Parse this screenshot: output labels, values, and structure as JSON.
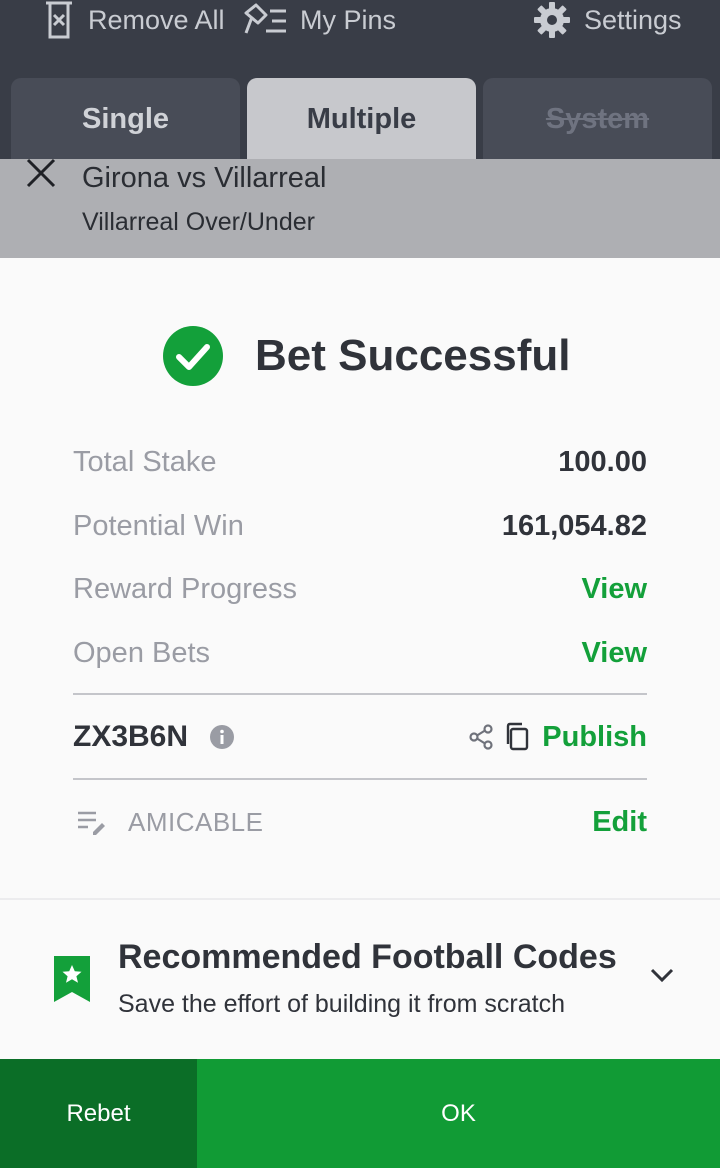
{
  "toolbar": {
    "remove_all": "Remove All",
    "my_pins": "My Pins",
    "settings": "Settings"
  },
  "tabs": [
    {
      "label": "Single",
      "state": "inactive"
    },
    {
      "label": "Multiple",
      "state": "active"
    },
    {
      "label": "System",
      "state": "disabled"
    }
  ],
  "selection": {
    "match": "Girona vs Villarreal",
    "market": "Villarreal Over/Under"
  },
  "result": {
    "title": "Bet Successful",
    "rows": [
      {
        "label": "Total Stake",
        "value": "100.00"
      },
      {
        "label": "Potential Win",
        "value": "161,054.82"
      },
      {
        "label": "Reward Progress",
        "value": "View"
      },
      {
        "label": "Open Bets",
        "value": "View"
      }
    ],
    "booking_code": "ZX3B6N",
    "publish_label": "Publish",
    "note": "AMICABLE",
    "edit_label": "Edit"
  },
  "recommended": {
    "title": "Recommended Football Codes",
    "subtitle": "Save the effort of building it from scratch"
  },
  "actions": {
    "rebet": "Rebet",
    "ok": "OK"
  },
  "colors": {
    "accent_green": "#13a03a",
    "ok_button": "#119b35",
    "rebet_button": "#0b6e27",
    "toolbar_bg": "#393d47"
  },
  "icons": {
    "remove_all": "trash-x-icon",
    "my_pins": "pins-list-icon",
    "settings": "gear-icon",
    "success": "check-circle-icon",
    "info": "info-icon",
    "share": "share-icon",
    "copy": "copy-icon",
    "note": "edit-note-icon",
    "recommended": "bookmark-star-icon",
    "expand": "chevron-down-icon",
    "close": "close-icon"
  }
}
